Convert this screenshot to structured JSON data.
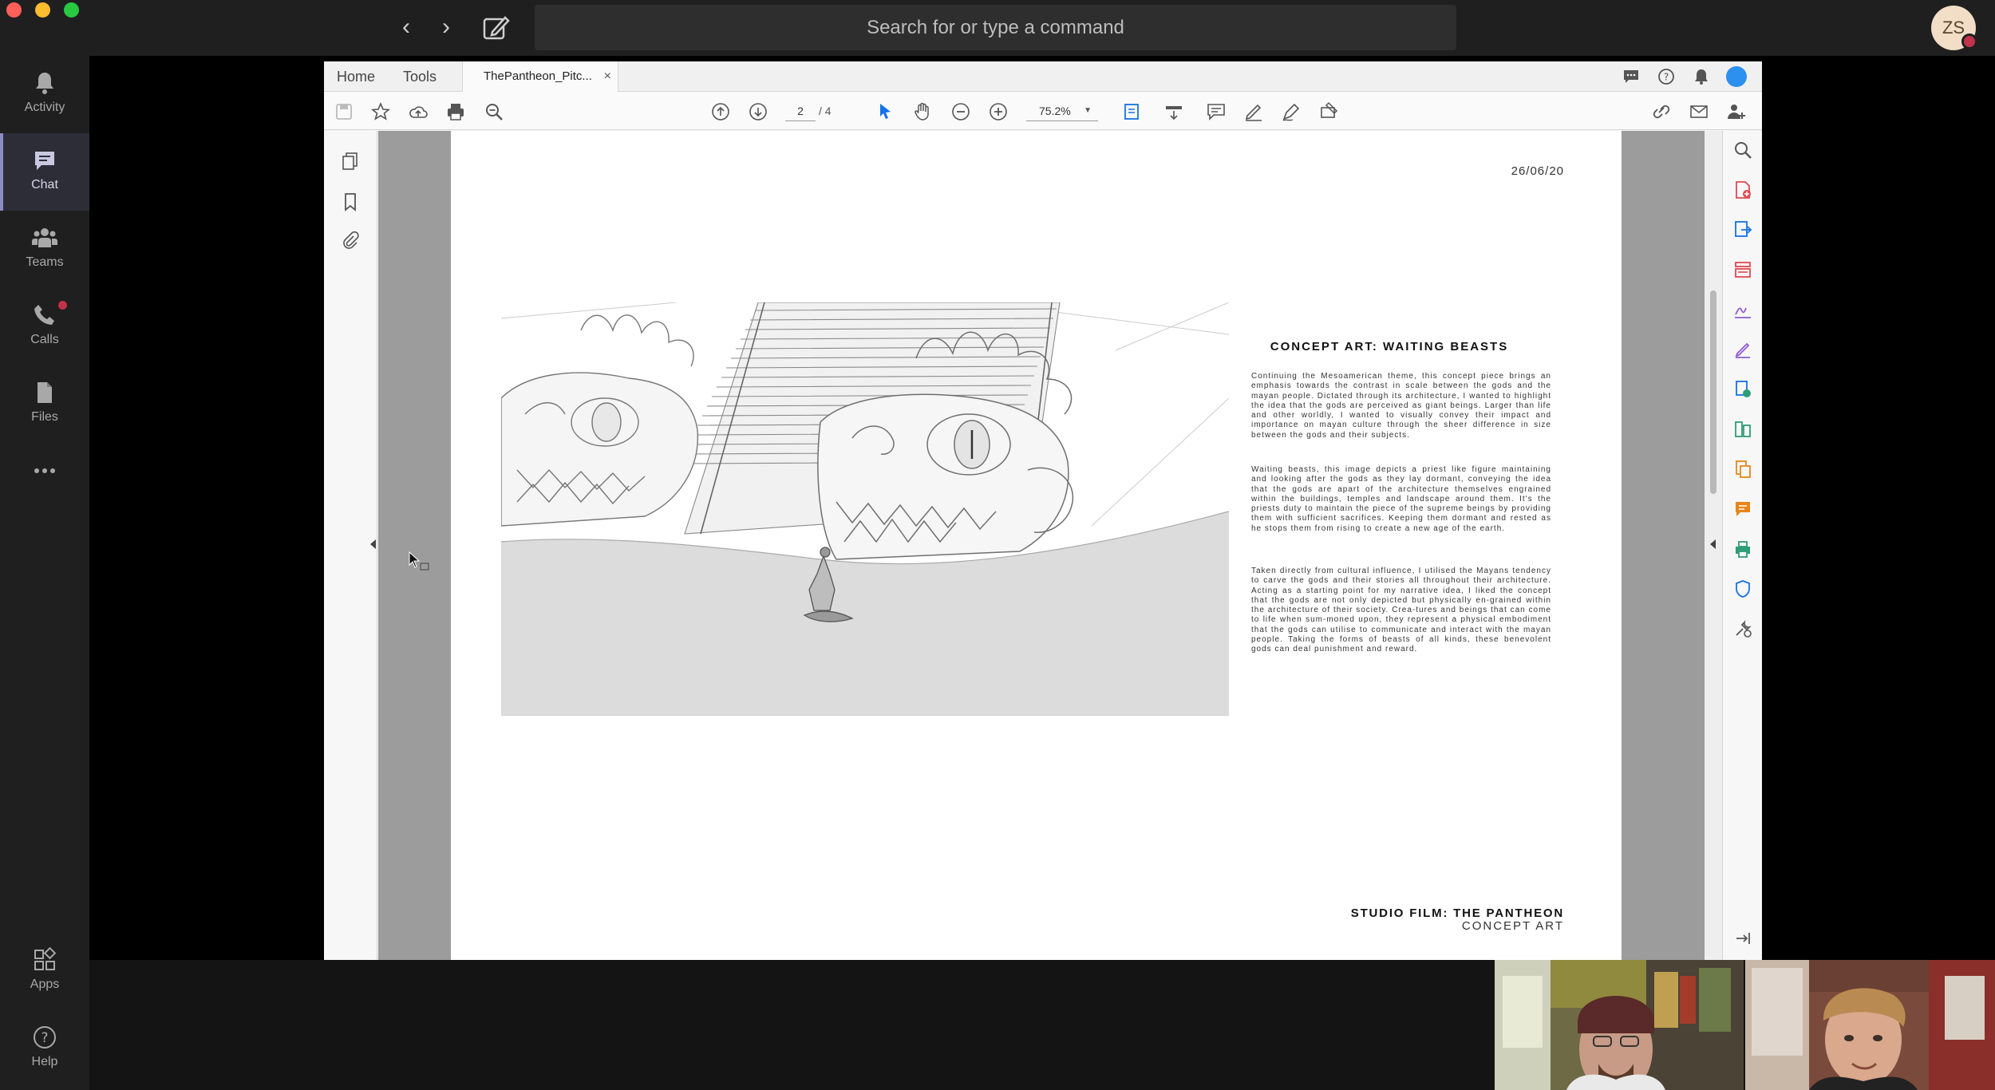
{
  "teams": {
    "search_placeholder": "Search for or type a command",
    "avatar_initials": "ZS",
    "rail": [
      {
        "label": "Activity",
        "icon": "bell-icon"
      },
      {
        "label": "Chat",
        "icon": "chat-icon"
      },
      {
        "label": "Teams",
        "icon": "teams-icon"
      },
      {
        "label": "Calls",
        "icon": "phone-icon"
      },
      {
        "label": "Files",
        "icon": "file-icon"
      },
      {
        "label": "",
        "icon": "more-icon"
      },
      {
        "label": "Apps",
        "icon": "apps-icon"
      },
      {
        "label": "Help",
        "icon": "help-icon"
      }
    ]
  },
  "acrobat": {
    "tabs": {
      "home": "Home",
      "tools": "Tools",
      "document": "ThePantheon_Pitc...",
      "close": "×"
    },
    "toolbar": {
      "page_current": "2",
      "page_total": "/ 4",
      "zoom": "75.2%"
    },
    "colors": {
      "accent_blue": "#1473e6",
      "tool_red": "#e34850",
      "tool_purple": "#8f5bd6",
      "tool_green": "#2d9d78",
      "tool_yellow": "#e68619"
    }
  },
  "document": {
    "date": "26/06/20",
    "heading": "CONCEPT ART: WAITING BEASTS",
    "paragraphs": [
      "Continuing the Mesoamerican theme, this concept piece brings an emphasis towards the contrast in scale between the gods and the mayan people. Dictated through its architecture, I wanted to highlight the idea that the gods are perceived as giant beings. Larger than life and other worldly, I wanted to visually convey their impact and importance on mayan culture through the sheer difference in size between the gods and their subjects.",
      "Waiting beasts, this image depicts a priest like figure maintaining and looking after the gods as they lay dormant, conveying the idea that the gods are apart of the architecture themselves engrained within the buildings, temples and landscape around them. It's the priests duty to maintain the piece of the supreme beings by providing them with sufficient sacrifices. Keeping them dormant and rested as he stops them from rising to create a new age of the earth.",
      "Taken directly from cultural influence, I utilised the Mayans tendency to carve the gods and their stories all throughout their architecture. Acting as a starting point for my narrative idea, I liked the concept that the gods are not only depicted but physically en-grained within the architecture of their society. Crea-tures and beings that can come to life when sum-moned upon, they represent a physical embodiment that the gods can utilise to communicate and interact with the mayan people. Taking the forms of beasts of all kinds, these benevolent gods can deal punishment and reward."
    ],
    "footer_title": "STUDIO FILM: THE PANTHEON",
    "footer_subtitle": "CONCEPT ART"
  }
}
